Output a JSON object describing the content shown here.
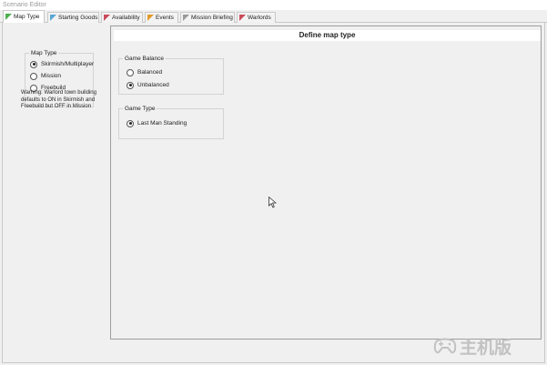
{
  "window": {
    "title": "Scenario Editor"
  },
  "tabs": [
    {
      "label": "Map Type",
      "color": "#4caf50",
      "active": true
    },
    {
      "label": "Starting Goods",
      "color": "#5aa6d6",
      "active": false
    },
    {
      "label": "Availability",
      "color": "#c94b5a",
      "active": false
    },
    {
      "label": "Events",
      "color": "#e39a2a",
      "active": false
    },
    {
      "label": "Mission Briefing",
      "color": "#9a9a9a",
      "active": false
    },
    {
      "label": "Warlords",
      "color": "#c94b5a",
      "active": false
    }
  ],
  "map_type": {
    "legend": "Map Type",
    "options": [
      {
        "label": "Skirmish/Multiplayer",
        "checked": true
      },
      {
        "label": "Mission",
        "checked": false
      },
      {
        "label": "Freebuild",
        "checked": false
      }
    ],
    "warning": "Warning: Warlord town building defaults to ON in Skirmish and Freebuild but OFF in Mission"
  },
  "main": {
    "header": "Define map type",
    "game_balance": {
      "legend": "Game Balance",
      "options": [
        {
          "label": "Balanced",
          "checked": false
        },
        {
          "label": "Unbalanced",
          "checked": true
        }
      ]
    },
    "game_type": {
      "legend": "Game Type",
      "options": [
        {
          "label": "Last Man Standing",
          "checked": true
        }
      ]
    }
  },
  "watermark": {
    "text": "主机版",
    "icon": "gamepad-icon"
  }
}
